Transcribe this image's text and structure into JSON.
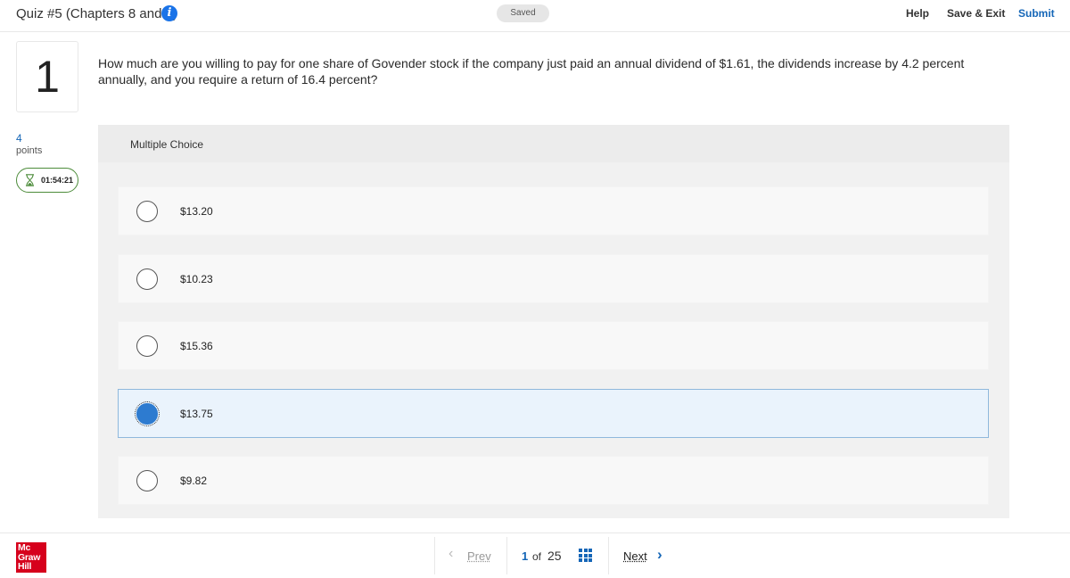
{
  "header": {
    "quiz_title": "Quiz #5 (Chapters 8 and 9)",
    "saved_status": "Saved",
    "help_label": "Help",
    "save_exit_label": "Save & Exit",
    "submit_label": "Submit",
    "info_glyph": "i"
  },
  "question": {
    "number": "1",
    "points_value": "4",
    "points_label": "points",
    "timer": "01:54:21",
    "text": "How much are you willing to pay for one share of Govender stock if the company just paid an annual dividend of $1.61, the dividends increase by 4.2 percent annually, and you require a return of 16.4 percent?",
    "type_label": "Multiple Choice"
  },
  "options": [
    {
      "label": "$13.20",
      "selected": false
    },
    {
      "label": "$10.23",
      "selected": false
    },
    {
      "label": "$15.36",
      "selected": false
    },
    {
      "label": "$13.75",
      "selected": true
    },
    {
      "label": "$9.82",
      "selected": false
    }
  ],
  "footer": {
    "logo_line1": "Mc",
    "logo_line2": "Graw",
    "logo_line3": "Hill",
    "prev_label": "Prev",
    "current_page": "1",
    "of_label": "of",
    "total_pages": "25",
    "next_label": "Next"
  },
  "colors": {
    "accent": "#1566b7",
    "selected_radio": "#2d7bd0",
    "brand_red": "#d6001c",
    "timer_border": "#4c8c3a"
  }
}
